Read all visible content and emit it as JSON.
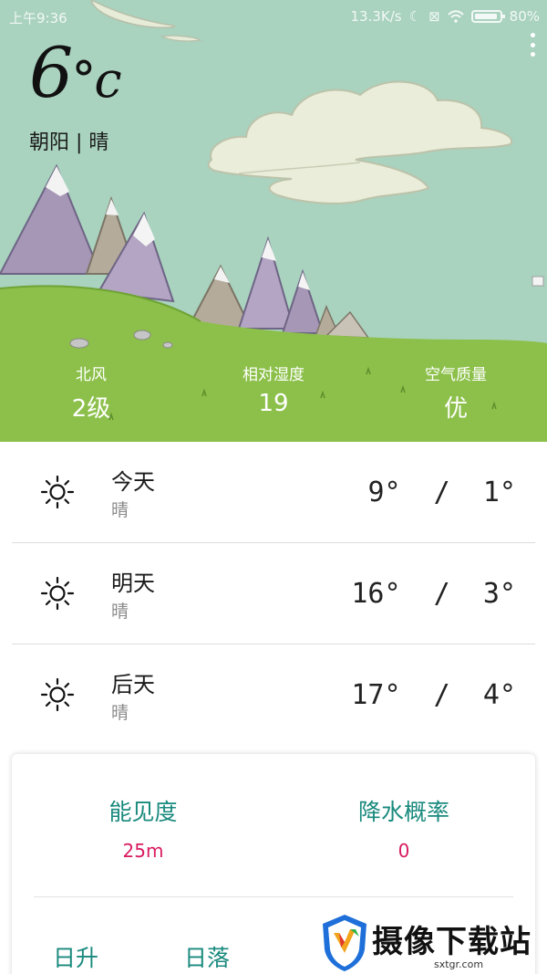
{
  "status_bar": {
    "time": "上午9:36",
    "network_speed": "13.3K/s",
    "battery": "80%",
    "icons": [
      "moon-icon",
      "no-sim-icon",
      "wifi-icon",
      "battery-icon"
    ]
  },
  "current": {
    "temperature": "6",
    "unit": "°c",
    "location_condition": "朝阳 | 晴"
  },
  "stats": [
    {
      "label": "北风",
      "value": "2级"
    },
    {
      "label": "相对湿度",
      "value": "19"
    },
    {
      "label": "空气质量",
      "value": "优"
    }
  ],
  "forecast": [
    {
      "day": "今天",
      "condition": "晴",
      "temps": "9°  /  1°",
      "icon": "sun-icon"
    },
    {
      "day": "明天",
      "condition": "晴",
      "temps": "16°  /  3°",
      "icon": "sun-icon"
    },
    {
      "day": "后天",
      "condition": "晴",
      "temps": "17°  /  4°",
      "icon": "sun-icon"
    }
  ],
  "details": {
    "visibility_label": "能见度",
    "visibility_value": "25m",
    "precip_label": "降水概率",
    "precip_value": "0",
    "sunrise_label": "日升",
    "sunset_label": "日落"
  },
  "watermark": {
    "text": "摄像下载站",
    "url": "sxtgr.com"
  },
  "colors": {
    "sky": "#a9d2bf",
    "grass": "#8cc04a",
    "accent_teal": "#1a8a7e",
    "accent_pink": "#d81b60"
  }
}
